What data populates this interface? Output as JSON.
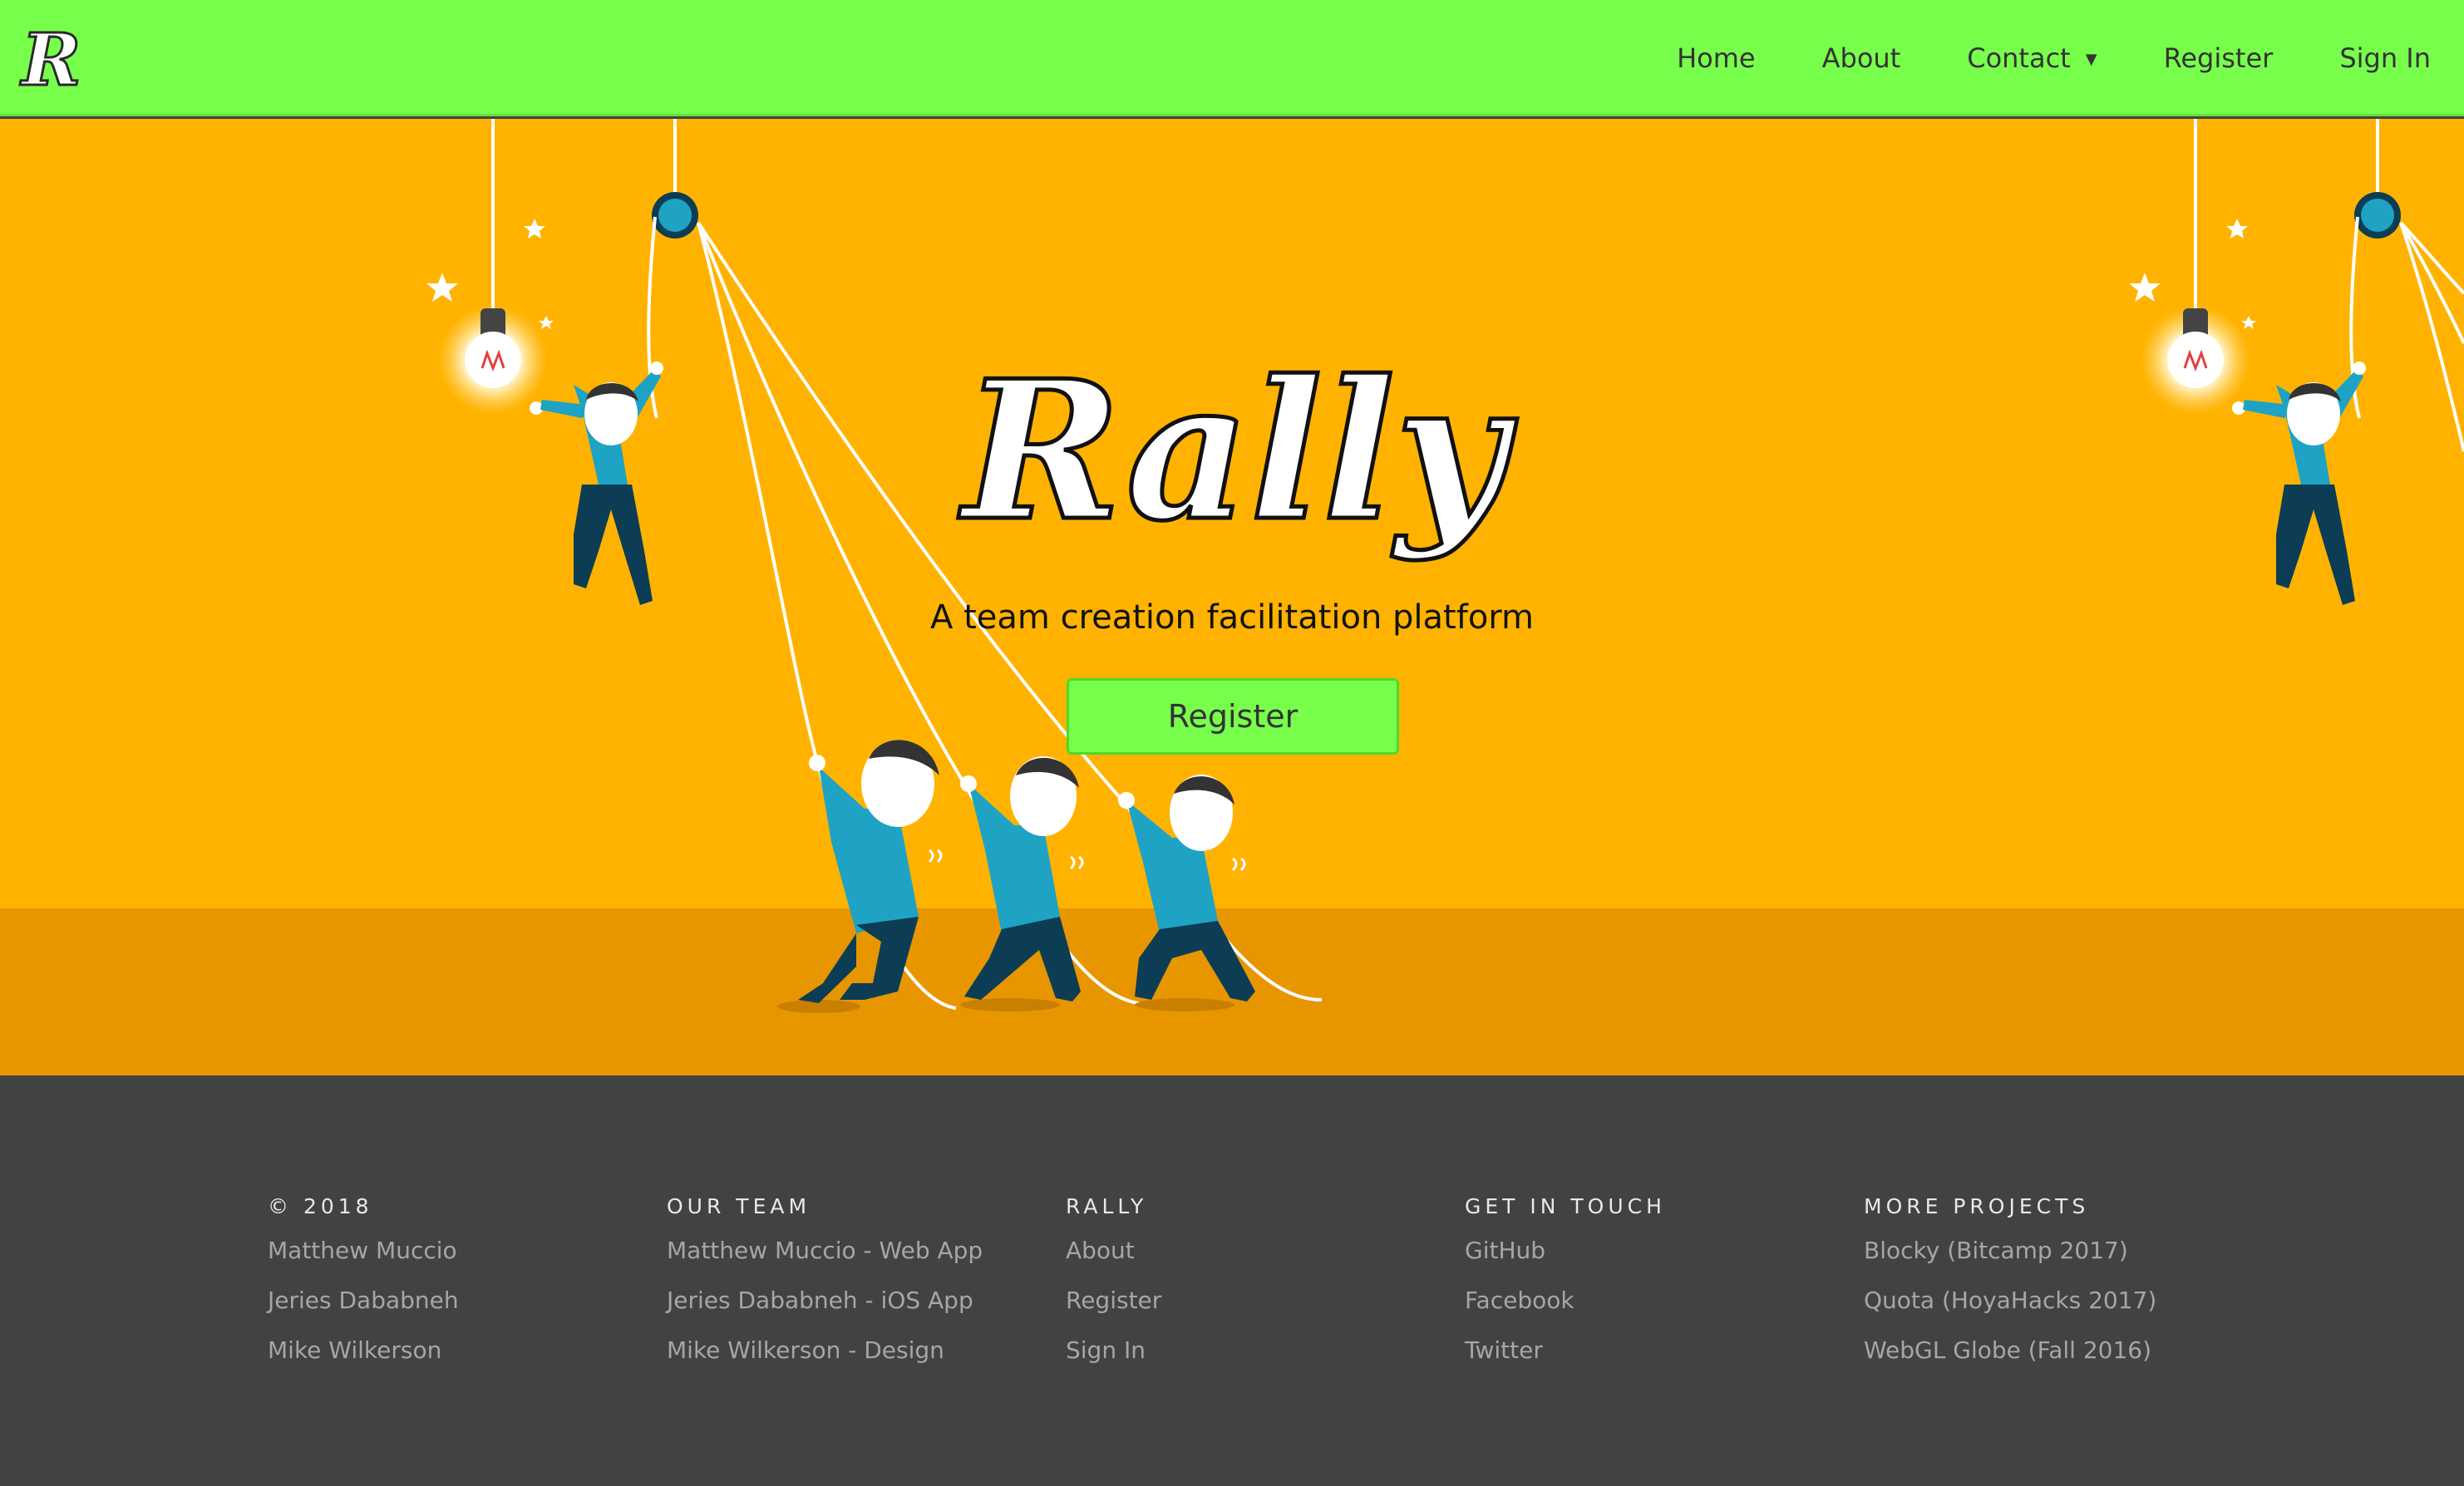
{
  "nav": {
    "logo_letter": "R",
    "links": [
      {
        "label": "Home"
      },
      {
        "label": "About"
      },
      {
        "label": "Contact",
        "has_dropdown": true
      },
      {
        "label": "Register"
      },
      {
        "label": "Sign In"
      }
    ]
  },
  "hero": {
    "logo_text": "Rally",
    "tagline": "A team creation facilitation platform",
    "register_label": "Register"
  },
  "footer": {
    "columns": [
      {
        "heading": "© 2018",
        "items": [
          "Matthew Muccio",
          "Jeries Dababneh",
          "Mike Wilkerson"
        ]
      },
      {
        "heading": "OUR TEAM",
        "items": [
          "Matthew Muccio - Web App",
          "Jeries Dababneh - iOS App",
          "Mike Wilkerson - Design"
        ]
      },
      {
        "heading": "RALLY",
        "items": [
          "About",
          "Register",
          "Sign In"
        ]
      },
      {
        "heading": "GET IN TOUCH",
        "items": [
          "GitHub",
          "Facebook",
          "Twitter"
        ]
      },
      {
        "heading": "MORE PROJECTS",
        "items": [
          "Blocky (Bitcamp 2017)",
          "Quota (HoyaHacks 2017)",
          "WebGL Globe (Fall 2016)"
        ]
      }
    ]
  },
  "colors": {
    "nav_bg": "#78ff4c",
    "hero_bg": "#ffb300",
    "hero_floor": "#e89600",
    "footer_bg": "#424242",
    "figure_shirt": "#1ea3c4",
    "figure_pants": "#0c3d54"
  }
}
